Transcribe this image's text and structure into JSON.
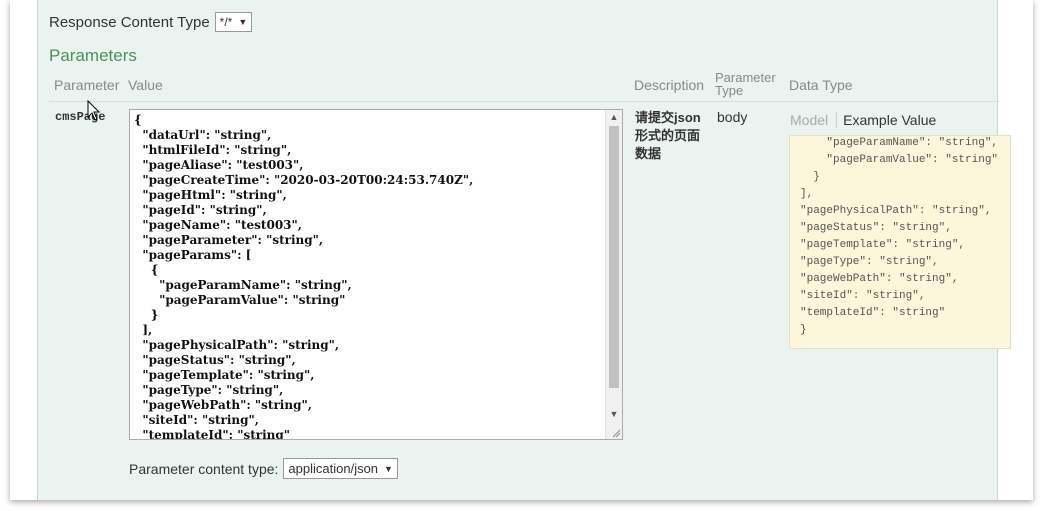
{
  "response_content_type": {
    "label": "Response Content Type",
    "value": "*/*"
  },
  "parameters": {
    "title": "Parameters",
    "headers": {
      "parameter": "Parameter",
      "value": "Value",
      "description": "Description",
      "parameter_type_line1": "Parameter",
      "parameter_type_line2": "Type",
      "data_type": "Data Type"
    },
    "row": {
      "name": "cmsPage",
      "value": "{\n  \"dataUrl\": \"string\",\n  \"htmlFileId\": \"string\",\n  \"pageAliase\": \"test003\",\n  \"pageCreateTime\": \"2020-03-20T00:24:53.740Z\",\n  \"pageHtml\": \"string\",\n  \"pageId\": \"string\",\n  \"pageName\": \"test003\",\n  \"pageParameter\": \"string\",\n  \"pageParams\": [\n    {\n      \"pageParamName\": \"string\",\n      \"pageParamValue\": \"string\"\n    }\n  ],\n  \"pagePhysicalPath\": \"string\",\n  \"pageStatus\": \"string\",\n  \"pageTemplate\": \"string\",\n  \"pageType\": \"string\",\n  \"pageWebPath\": \"string\",\n  \"siteId\": \"string\",\n  \"templateId\": \"string\"",
      "description": "请提交json形式的页面数据",
      "parameter_type": "body",
      "tabs": {
        "model": "Model",
        "example": "Example Value"
      },
      "example_value": "    \"pageParamName\": \"string\",\n    \"pageParamValue\": \"string\"\n  }\n],\n\"pagePhysicalPath\": \"string\",\n\"pageStatus\": \"string\",\n\"pageTemplate\": \"string\",\n\"pageType\": \"string\",\n\"pageWebPath\": \"string\",\n\"siteId\": \"string\",\n\"templateId\": \"string\"\n}"
    }
  },
  "parameter_content_type": {
    "label": "Parameter content type:",
    "value": "application/json"
  },
  "colors": {
    "panel_bg": "#ebf3f0",
    "title_green": "#4d9155",
    "example_bg": "#fcf6db"
  }
}
